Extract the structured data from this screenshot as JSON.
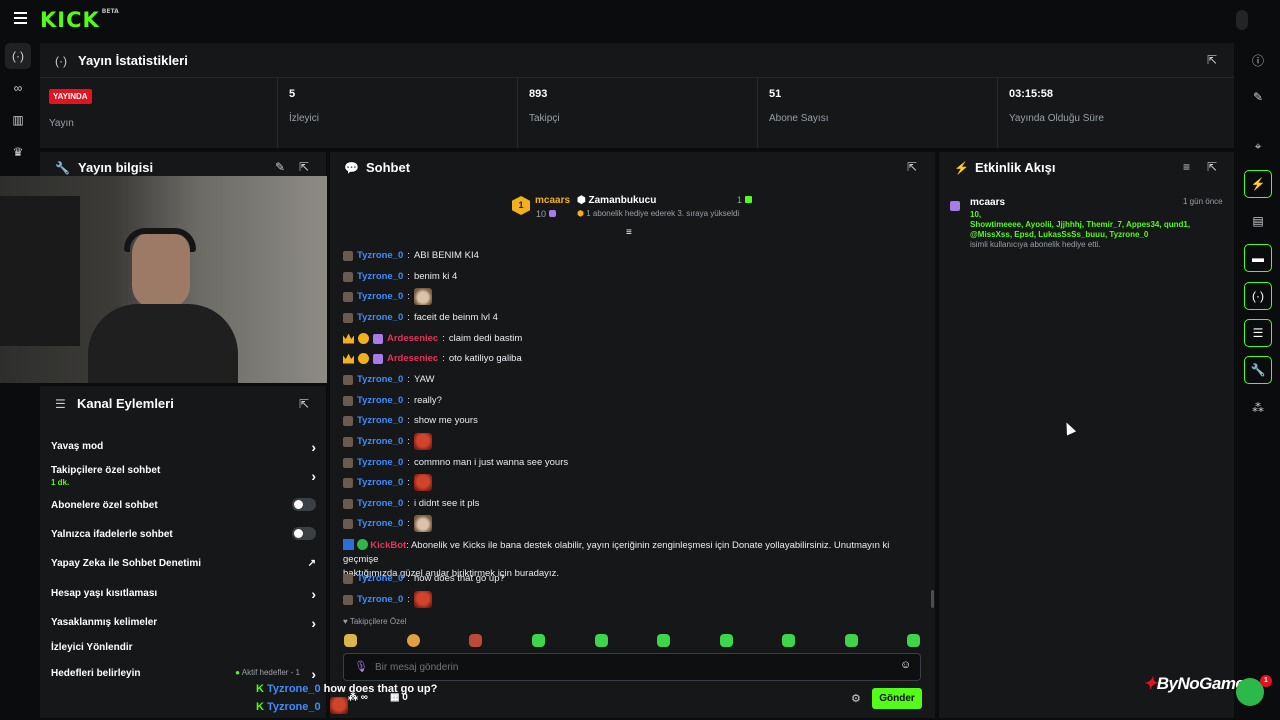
{
  "brand": {
    "logo": "KICK",
    "badge": "BETA"
  },
  "icons": {
    "menu": "hamburger-icon",
    "profile": "avatar-icon"
  },
  "stats": {
    "title": "Yayın İstatistikleri",
    "items": [
      {
        "value": "YAYINDA",
        "label": "Yayın"
      },
      {
        "value": "5",
        "label": "İzleyici"
      },
      {
        "value": "893",
        "label": "Takipçi"
      },
      {
        "value": "51",
        "label": "Abone Sayısı"
      },
      {
        "value": "03:15:58",
        "label": "Yayında Olduğu Süre"
      }
    ]
  },
  "stream_info": {
    "title": "Yayın bilgisi"
  },
  "channel_actions": {
    "title": "Kanal Eylemleri",
    "rows": [
      {
        "label": "Yavaş mod"
      },
      {
        "label": "Takipçilere özel sohbet",
        "sub": "1 dk."
      },
      {
        "label": "Abonelere özel sohbet"
      },
      {
        "label": "Yalnızca ifadelerle sohbet"
      },
      {
        "label": "Yapay Zeka ile Sohbet Denetimi"
      },
      {
        "label": "Hesap yaşı kısıtlaması"
      },
      {
        "label": "Yasaklanmış kelimeler"
      },
      {
        "label": "İzleyici Yönlendir"
      },
      {
        "label": "Hedefleri belirleyin",
        "status": "Aktif hedefler - 1"
      }
    ]
  },
  "chat": {
    "title": "Sohbet",
    "pinned": {
      "rank": "1",
      "user": "mcaars",
      "count": "10",
      "target": "Zamanbukucu",
      "target_count": "1",
      "message": "1 abonelik hediye ederek 3. sıraya yükseldi"
    },
    "messages": [
      {
        "user": "Tyzrone_0",
        "text": "ABI BENIM KI4"
      },
      {
        "user": "Tyzrone_0",
        "text": "benim ki 4"
      },
      {
        "user": "Tyzrone_0",
        "text": "",
        "emote": "cat-emote"
      },
      {
        "user": "Tyzrone_0",
        "text": "faceit de beinm lvl 4"
      },
      {
        "user": "Ardeseniec",
        "text": "claim dedi bastim"
      },
      {
        "user": "Ardeseniec",
        "text": "oto katiliyo galiba"
      },
      {
        "user": "Tyzrone_0",
        "text": "YAW"
      },
      {
        "user": "Tyzrone_0",
        "text": "really?"
      },
      {
        "user": "Tyzrone_0",
        "text": "show me yours"
      },
      {
        "user": "Tyzrone_0",
        "text": "",
        "emote": "red-face-emote"
      },
      {
        "user": "Tyzrone_0",
        "text": "commno man i just wanna see yours"
      },
      {
        "user": "Tyzrone_0",
        "text": "",
        "emote": "red-face-emote"
      },
      {
        "user": "Tyzrone_0",
        "text": "i didnt see it pls"
      },
      {
        "user": "Tyzrone_0",
        "text": "",
        "emote": "cat-emote"
      },
      {
        "user": "KickBot",
        "text": "Abonelik ve Kicks ile bana destek olabilir, yayın içeriğinin zenginleşmesi için Donate yollayabilirsiniz. Unutmayın ki geçmişe",
        "text2": "baktığımızda güzel anılar biriktirmek için buradayız."
      },
      {
        "user": "Tyzrone_0",
        "text": "how does that go up?"
      },
      {
        "user": "Tyzrone_0",
        "text": "",
        "emote": "red-face-emote"
      }
    ],
    "followers_only_label": "Takipçilere Özel",
    "input_placeholder": "Bir mesaj gönderin",
    "send_label": "Gönder"
  },
  "events": {
    "title": "Etkinlik Akışı",
    "items": [
      {
        "user": "mcaars",
        "time": "1 gün önce",
        "count": "10,",
        "recipients_1": "Showtimeeee, Ayoolii, Jjjhhhj, Themir_7, Appes34, qund1,",
        "recipients_2": "@MissXss, Epsd, LukasSsSs_buuu, Tyzrone_0",
        "suffix": "isimli kullanıcıya abonelik hediye etti."
      }
    ]
  },
  "overlay": {
    "chat_1_user": "Tyzrone_0",
    "chat_1_text": "how does that go up?",
    "chat_2_user": "Tyzrone_0",
    "stat_inf": "∞",
    "stat_zero": "0",
    "watermark": "ByNoGame",
    "notification_count": "1"
  },
  "colors": {
    "accent": "#53fc18",
    "live": "#e4131f",
    "username_blue": "#3f8cff",
    "username_red": "#e2335b"
  }
}
